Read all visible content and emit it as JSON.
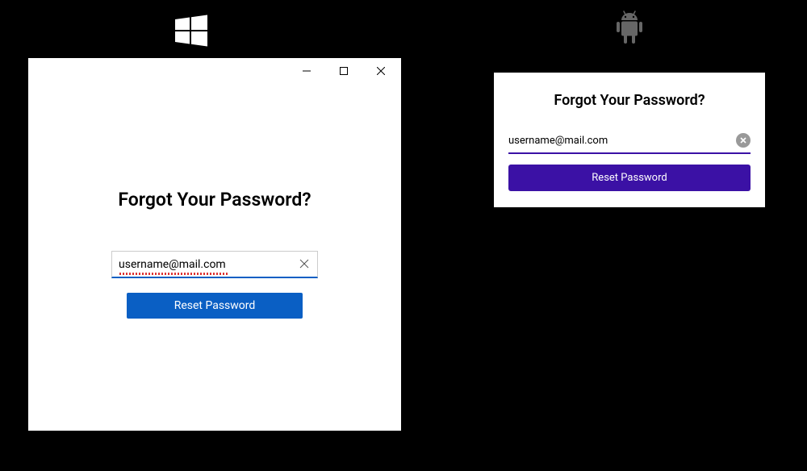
{
  "windows": {
    "heading": "Forgot Your Password?",
    "email_value": "username@mail.com",
    "reset_button": "Reset Password"
  },
  "android": {
    "heading": "Forgot Your Password?",
    "email_value": "username@mail.com",
    "reset_button": "Reset Password"
  },
  "colors": {
    "windows_primary": "#0a5fc4",
    "android_primary": "#3b11a5"
  }
}
